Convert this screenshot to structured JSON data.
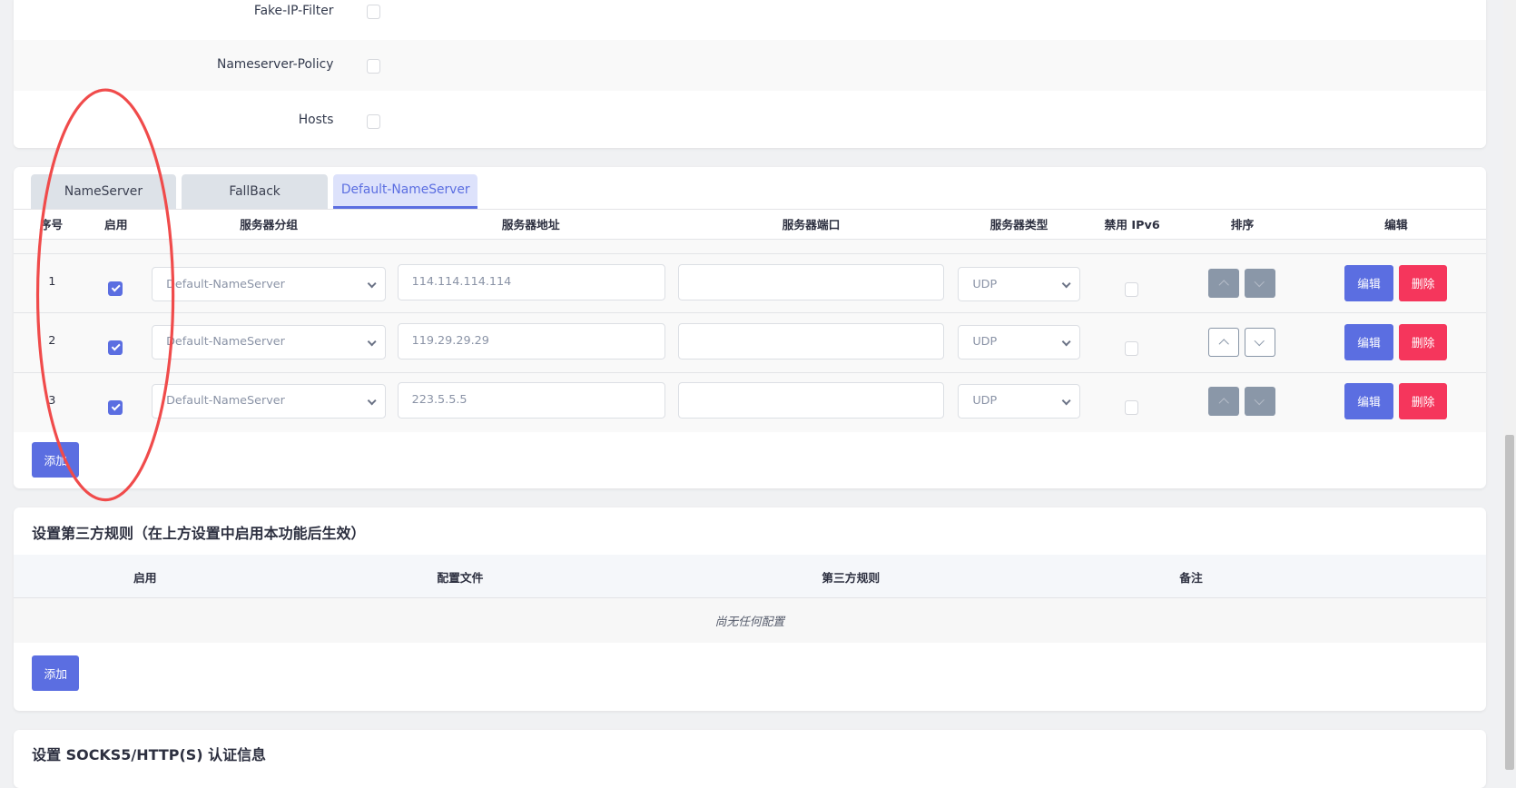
{
  "settings": [
    {
      "label": "Fake-IP-Filter",
      "checked": false
    },
    {
      "label": "Nameserver-Policy",
      "checked": false
    },
    {
      "label": "Hosts",
      "checked": false
    }
  ],
  "dns": {
    "tabs": [
      "NameServer",
      "FallBack",
      "Default-NameServer"
    ],
    "active_tab": 2,
    "headers": [
      "序号",
      "启用",
      "服务器分组",
      "服务器地址",
      "服务器端口",
      "服务器类型",
      "禁用 IPv6",
      "排序",
      "编辑"
    ],
    "rows": [
      {
        "index": "1",
        "group": "Default-NameServer",
        "address": "114.114.114.114",
        "port": "",
        "type": "UDP"
      },
      {
        "index": "2",
        "group": "Default-NameServer",
        "address": "119.29.29.29",
        "port": "",
        "type": "UDP"
      },
      {
        "index": "3",
        "group": "Default-NameServer",
        "address": "223.5.5.5",
        "port": "",
        "type": "UDP"
      }
    ],
    "edit_label": "编辑",
    "delete_label": "删除",
    "add_label": "添加"
  },
  "third_party": {
    "title": "设置第三方规则（在上方设置中启用本功能后生效）",
    "headers": [
      "启用",
      "配置文件",
      "第三方规则",
      "备注"
    ],
    "empty": "尚无任何配置",
    "add_label": "添加"
  },
  "socks": {
    "title": "设置 SOCKS5/HTTP(S) 认证信息"
  },
  "colors": {
    "accent": "#5b6ee1",
    "danger": "#f5365c",
    "annotation": "#f04b4b"
  }
}
